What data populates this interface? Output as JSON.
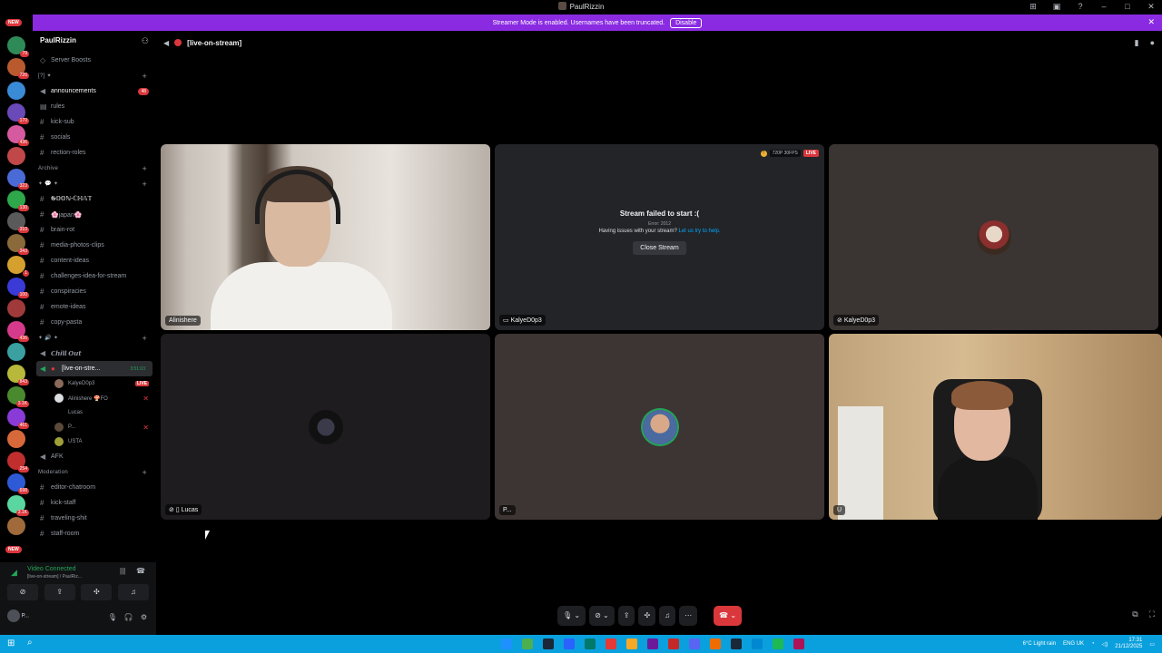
{
  "window": {
    "title": "PaulRizzin"
  },
  "banner": {
    "text": "Streamer Mode is enabled. Usernames have been truncated.",
    "disable_label": "Disable"
  },
  "rail": {
    "new_top": "NEW",
    "new_bottom": "NEW",
    "counts": [
      "79",
      "726",
      "170",
      "436",
      "323",
      "130",
      "310",
      "343",
      "1",
      "100",
      "436",
      "843",
      "3.1K",
      "461",
      "254",
      "698",
      "3.1K"
    ]
  },
  "server": {
    "name": "PaulRizzin"
  },
  "sidebar": {
    "boosts": "Server Boosts",
    "cat1": "[?] ✦",
    "cat1_items": [
      {
        "name": "announcements",
        "badge": "48"
      },
      {
        "name": "rules"
      },
      {
        "name": "kick-sub"
      },
      {
        "name": "socials"
      },
      {
        "name": "rection-roles"
      }
    ],
    "cat2": "Archive",
    "cat3": "✦ 💬 ✦",
    "cat3_items": [
      "𝕲𝕆𝕆ℕ-ℂℍ𝔸𝕋",
      "🌸japan🌸",
      "brain-rot",
      "media-photos-clips",
      "content-ideas",
      "challenges-idea-for-stream",
      "conspiracies",
      "emote-ideas",
      "copy-pasta"
    ],
    "cat4": "✦ 🔊 ✦",
    "chill": "𝘾𝙝𝙞𝙡𝙡 𝙊𝙪𝙩",
    "voice_channel": "[live-on-stre...",
    "voice_timer": "3:51:03",
    "voice_users": [
      "KalyeD0p3",
      "Alinishere 🍄FO",
      "Lucas",
      "P...",
      "USTA"
    ],
    "live_label": "LIVE",
    "afk": "AFK",
    "cat5": "Moderation",
    "mod_items": [
      "editor-chatroom",
      "kick-staff",
      "traveling-shit",
      "staff-room"
    ]
  },
  "voice": {
    "status": "Video Connected",
    "channel": "[live-on-stream] / PaulRiz..."
  },
  "user": {
    "name": "P..."
  },
  "header": {
    "channel": "[live-on-stream]"
  },
  "tiles": {
    "t1_name": "Alinishere",
    "t2_name": "KalyeD0p3",
    "t2_quality": "720P 30FPS",
    "t2_live": "LIVE",
    "t2_error_title": "Stream failed to start :(",
    "t2_error_code": "Error: 2012",
    "t2_help": "Having issues with your stream?",
    "t2_help_link": "Let us try to help.",
    "t2_close": "Close Stream",
    "t3_name": "KalyeD0p3",
    "t4_name": "Lucas",
    "t5_name": "P...",
    "t6_name": "U"
  },
  "taskbar": {
    "weather": "6°C  Light rain",
    "lang": "ENG UK",
    "time": "17:31",
    "date": "21/12/2025"
  },
  "colors": {
    "accent": "#8a2be2",
    "danger": "#da373c",
    "online": "#23a55a",
    "taskbar": "#0aa0dd"
  }
}
